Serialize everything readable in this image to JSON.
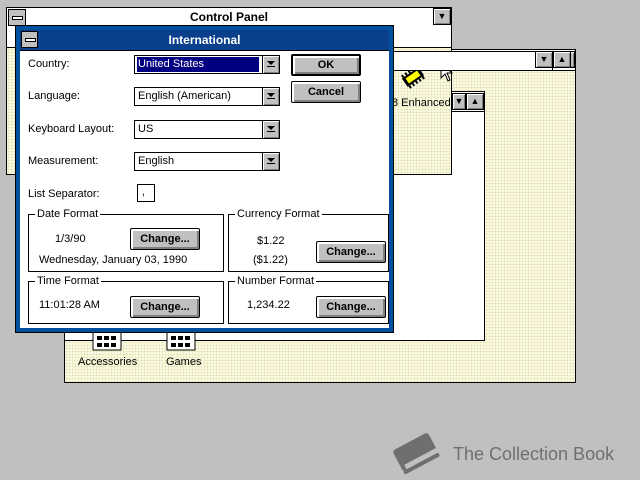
{
  "control_panel": {
    "title": "Control Panel",
    "enhanced_label": "8 Enhanced"
  },
  "program_manager": {
    "groups": [
      {
        "label": "Accessories",
        "icon": "program-group-icon"
      },
      {
        "label": "Games",
        "icon": "program-group-icon"
      }
    ]
  },
  "dialog": {
    "title": "International",
    "fields": {
      "country": {
        "label": "Country:",
        "value": "United States"
      },
      "language": {
        "label": "Language:",
        "value": "English (American)"
      },
      "keyboard": {
        "label": "Keyboard Layout:",
        "value": "US"
      },
      "measurement": {
        "label": "Measurement:",
        "value": "English"
      },
      "separator": {
        "label": "List Separator:",
        "value": ","
      }
    },
    "buttons": {
      "ok": "OK",
      "cancel": "Cancel",
      "change": "Change..."
    },
    "date_format": {
      "title": "Date Format",
      "short": "1/3/90",
      "long": "Wednesday, January 03, 1990"
    },
    "currency_format": {
      "title": "Currency Format",
      "positive": "$1.22",
      "negative": "($1.22)"
    },
    "time_format": {
      "title": "Time Format",
      "value": "11:01:28 AM"
    },
    "number_format": {
      "title": "Number Format",
      "value": "1,234.22"
    }
  },
  "watermark": {
    "text": "The Collection Book",
    "icon": "book-icon"
  },
  "colors": {
    "titlebar_active": "#0a3f8c",
    "desktop": "#c0c0c0",
    "selection": "#000080"
  }
}
